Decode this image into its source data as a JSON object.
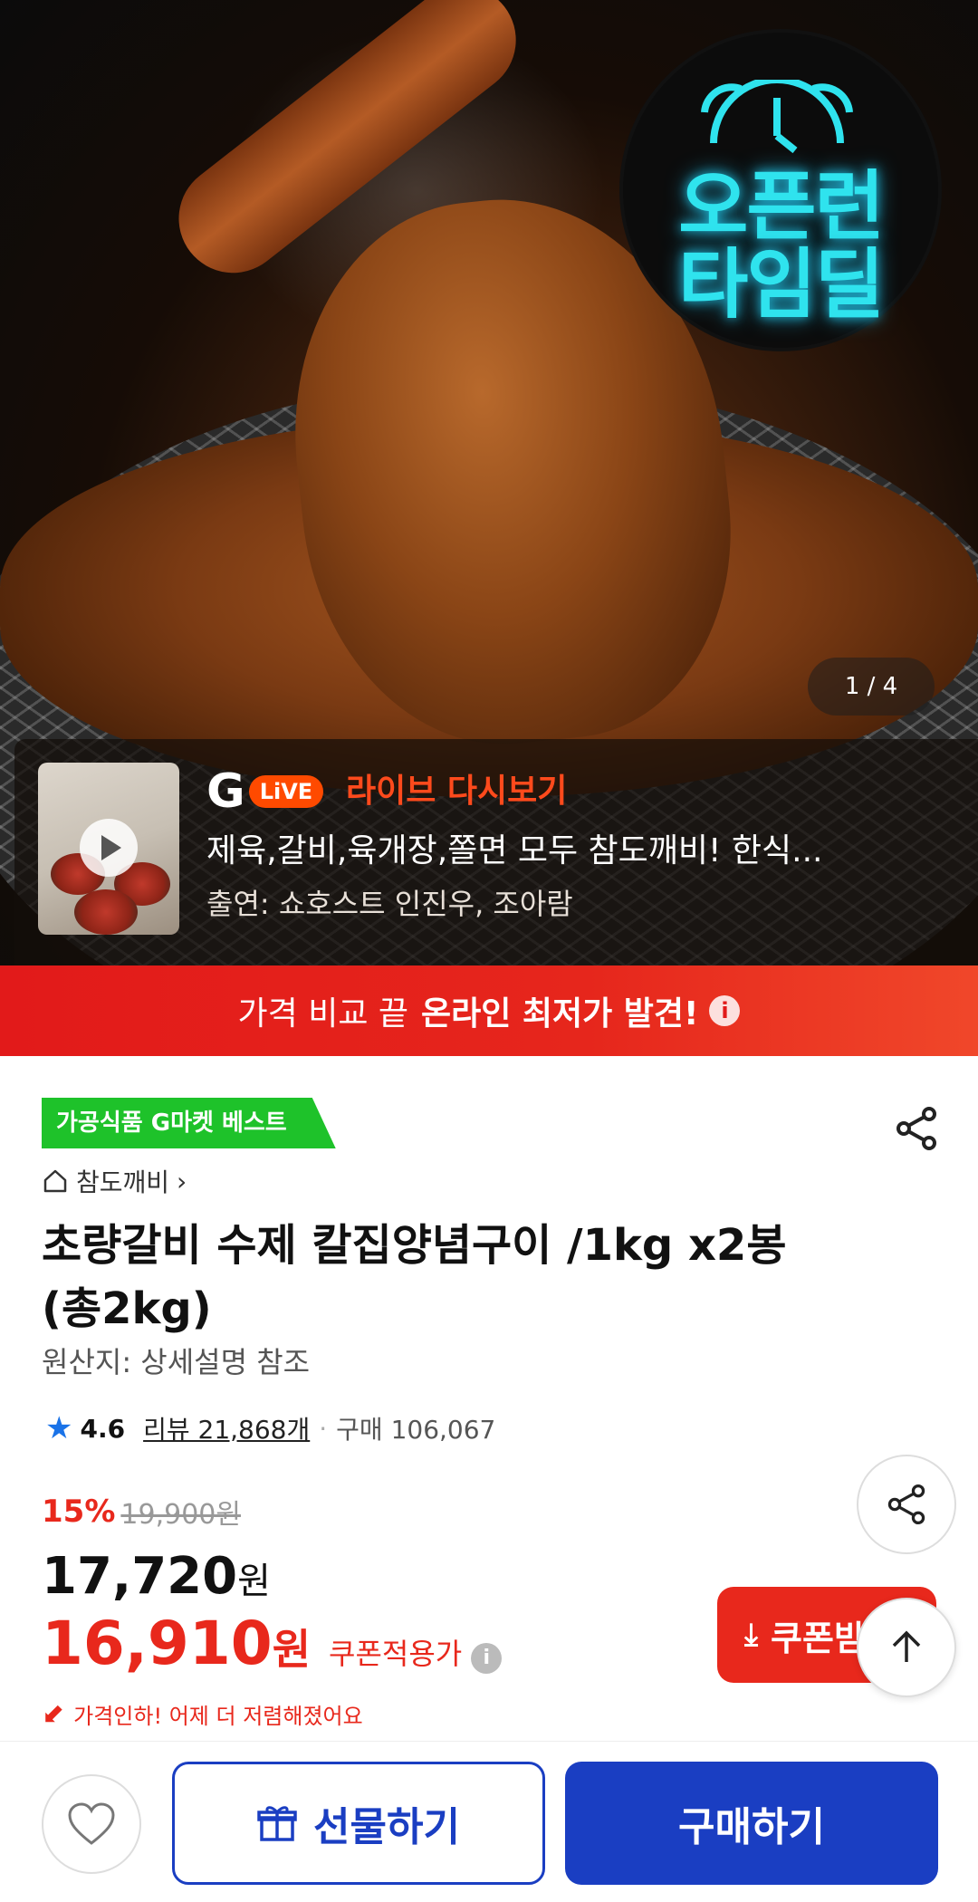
{
  "hero": {
    "badge_line1": "오픈런",
    "badge_line2": "타임딜",
    "image_counter": "1 / 4",
    "live": {
      "brand_g": "G",
      "brand_pill": "LiVE",
      "title": "라이브 다시보기",
      "description": "제육,갈비,육개장,쫄면 모두 참도깨비! 한식...",
      "cast": "출연: 쇼호스트 인진우, 조아람"
    }
  },
  "banner": {
    "text_normal": "가격 비교 끝",
    "text_bold": "온라인 최저가 발견!",
    "info_icon": "i"
  },
  "product": {
    "best_tag": "가공식품 G마켓 베스트",
    "brand": "참도깨비",
    "title": "초량갈비 수제 칼집양념구이 /1kg x2봉 (총2kg)",
    "origin": "원산지: 상세설명 참조",
    "rating": "4.6",
    "review_label": "리뷰 21,868개",
    "separator": "·",
    "purchase_label": "구매 106,067"
  },
  "pricing": {
    "discount_pct": "15%",
    "original_price": "19,900원",
    "sale_price": "17,720",
    "won": "원",
    "coupon_price": "16,910",
    "coupon_won": "원",
    "coupon_label": "쿠폰적용가",
    "info_icon": "i",
    "price_down_note": "가격인하! 어제 더 저렴해졌어요",
    "coupon_button": "쿠폰받"
  },
  "bottom_bar": {
    "gift_label": "선물하기",
    "buy_label": "구매하기"
  },
  "colors": {
    "accent_red": "#e8281c",
    "brand_blue": "#1a3ec2",
    "best_green": "#1ec22a",
    "neon_cyan": "#2fe3ee"
  },
  "icons": [
    "alarm-clock-icon",
    "play-icon",
    "info-icon",
    "share-icon",
    "home-icon",
    "chevron-right-icon",
    "star-icon",
    "down-arrow-icon",
    "download-icon",
    "arrow-up-icon",
    "heart-icon",
    "gift-icon"
  ]
}
